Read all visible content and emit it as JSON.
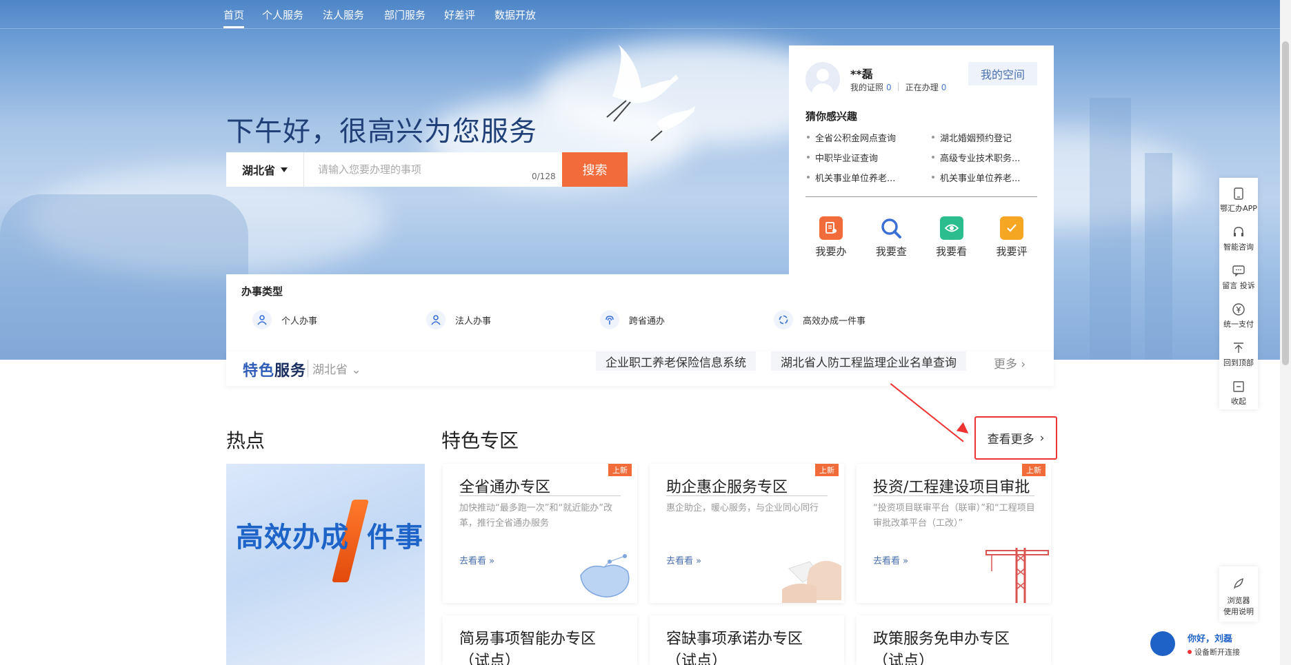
{
  "nav": {
    "items": [
      {
        "label": "首页",
        "active": true
      },
      {
        "label": "个人服务"
      },
      {
        "label": "法人服务"
      },
      {
        "label": "部门服务"
      },
      {
        "label": "好差评"
      },
      {
        "label": "数据开放"
      }
    ]
  },
  "hero": {
    "greeting": "下午好，很高兴为您服务"
  },
  "search": {
    "region": "湖北省",
    "placeholder": "请输入您要办理的事项",
    "value": "",
    "counter": "0/128",
    "button": "搜索"
  },
  "user": {
    "name": "**磊",
    "licenses_label": "我的证照",
    "licenses_count": "0",
    "processing_label": "正在办理",
    "processing_count": "0",
    "space_button": "我的空间",
    "interest_title": "猜你感兴趣",
    "interests": [
      "全省公积金网点查询",
      "湖北婚姻预约登记",
      "中职毕业证查询",
      "高级专业技术职务...",
      "机关事业单位养老...",
      "机关事业单位养老..."
    ],
    "actions": [
      {
        "label": "我要办",
        "icon": "handle-icon",
        "color": "#f26b3a"
      },
      {
        "label": "我要查",
        "icon": "search-icon",
        "color": "#3a6fd6"
      },
      {
        "label": "我要看",
        "icon": "eye-icon",
        "color": "#2bbd8e"
      },
      {
        "label": "我要评",
        "icon": "comment-check-icon",
        "color": "#f5a623"
      }
    ]
  },
  "service_types": {
    "title": "办事类型",
    "items": [
      {
        "label": "个人办事",
        "icon": "person-icon"
      },
      {
        "label": "法人办事",
        "icon": "corporate-person-icon"
      },
      {
        "label": "跨省通办",
        "icon": "signal-icon"
      },
      {
        "label": "高效办成一件事",
        "icon": "cycle-icon"
      }
    ]
  },
  "featured_bar": {
    "logo_a": "特色",
    "logo_b": "服务",
    "region": "湖北省",
    "tags": [
      "企业职工养老保险信息系统",
      "湖北省人防工程监理企业名单查询"
    ],
    "more": "更多"
  },
  "sections": {
    "hot_title": "热点",
    "featured_title": "特色专区",
    "view_more": "查看更多",
    "hot_banner_a": "高效办成",
    "hot_banner_b": "件事"
  },
  "cards": [
    {
      "title": "全省通办专区",
      "badge": "上新",
      "desc": "加快推动“最多跑一次”和“就近能办”改革，推行全省通办服务",
      "link": "去看看"
    },
    {
      "title": "助企惠企服务专区",
      "badge": "上新",
      "desc": "惠企助企，暖心服务，与企业同心同行",
      "link": "去看看"
    },
    {
      "title": "投资/工程建设项目审批",
      "badge": "上新",
      "desc": "“投资项目联审平台（联审）”和“工程项目审批改革平台（工改）”",
      "link": "去看看"
    },
    {
      "title": "简易事项智能办专区",
      "subtitle": "（试点）"
    },
    {
      "title": "容缺事项承诺办专区",
      "subtitle": "（试点）"
    },
    {
      "title": "政策服务免申办专区",
      "subtitle": "（试点）"
    }
  ],
  "toolbar": {
    "items": [
      {
        "label": "鄂汇办APP",
        "icon": "phone-icon"
      },
      {
        "label": "智能咨询",
        "icon": "headset-icon"
      },
      {
        "label": "留言 投诉",
        "icon": "message-icon"
      },
      {
        "label": "统一支付",
        "icon": "yuan-icon"
      },
      {
        "label": "回到顶部",
        "icon": "back-to-top-icon"
      },
      {
        "label": "收起",
        "icon": "collapse-icon"
      }
    ],
    "guide_a": "浏览器",
    "guide_b": "使用说明"
  },
  "assistant": {
    "hello": "你好，刘磊",
    "status": "设备断开连接"
  },
  "colors": {
    "accent": "#f26b3a",
    "brand_blue": "#1e62c7",
    "highlight_red": "#e33333"
  }
}
